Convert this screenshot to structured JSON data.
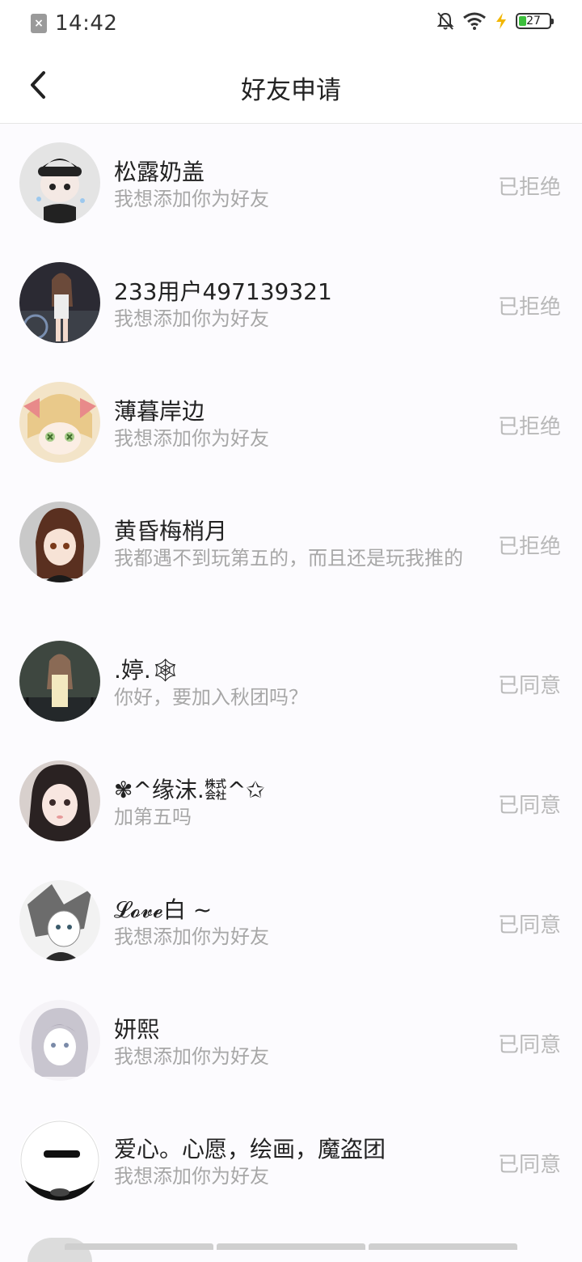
{
  "status_bar": {
    "time": "14:42",
    "battery": "27"
  },
  "header": {
    "title": "好友申请"
  },
  "requests": [
    {
      "name": "松露奶盖",
      "message": "我想添加你为好友",
      "status": "已拒绝"
    },
    {
      "name": "233用户497139321",
      "message": "我想添加你为好友",
      "status": "已拒绝"
    },
    {
      "name": "薄暮岸边",
      "message": "我想添加你为好友",
      "status": "已拒绝"
    },
    {
      "name": "黄昏梅梢月",
      "message": "我都遇不到玩第五的，而且还是玩我推的",
      "status": "已拒绝"
    },
    {
      "name": ".婷.🕸",
      "message": "你好，要加入秋团吗？",
      "status": "已同意"
    },
    {
      "name": "✾^缘沫.㍿^✩",
      "message": "加第五吗",
      "status": "已同意"
    },
    {
      "name": "𝓛𝓸𝓿𝓮白 ~",
      "message": "我想添加你为好友",
      "status": "已同意"
    },
    {
      "name": "妍熙",
      "message": "我想添加你为好友",
      "status": "已同意"
    },
    {
      "name": "爱心。心愿，绘画，魔盗团",
      "message": "我想添加你为好友",
      "status": "已同意"
    }
  ]
}
